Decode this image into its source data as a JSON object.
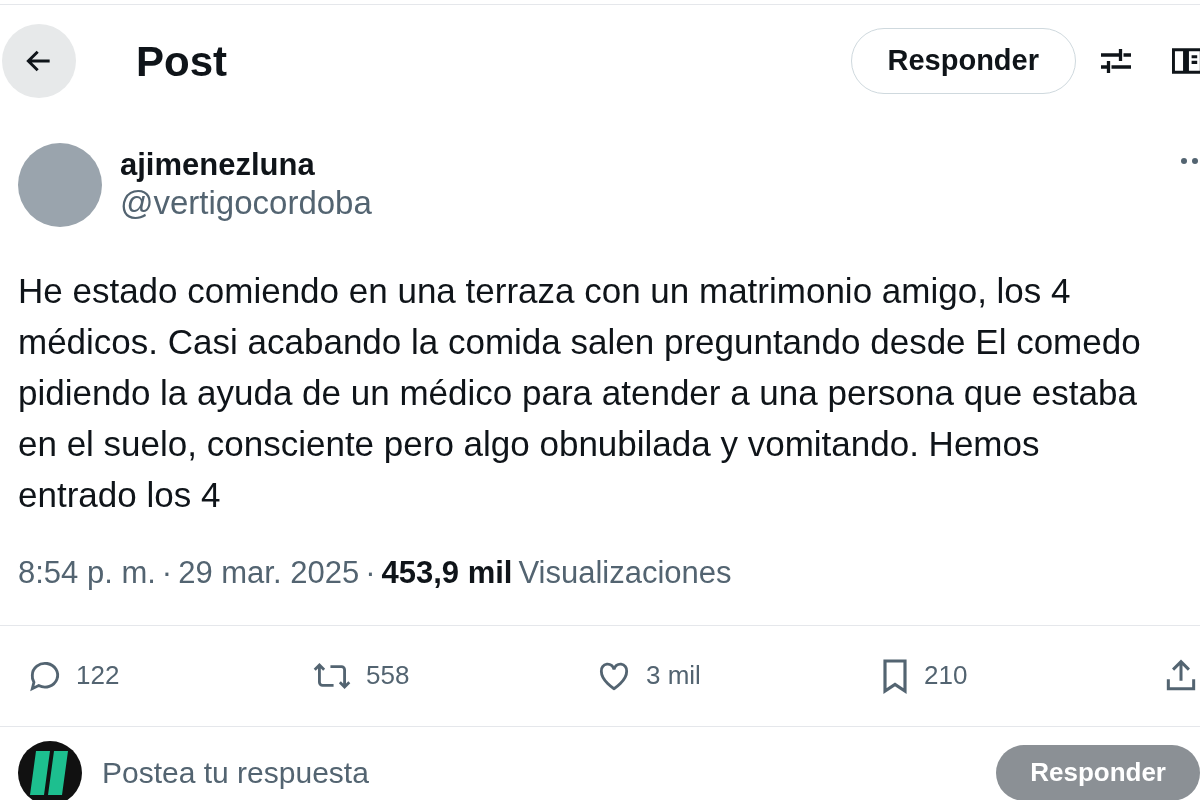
{
  "header": {
    "title": "Post",
    "reply_button": "Responder"
  },
  "author": {
    "name": "ajimenezluna",
    "handle": "@vertigocordoba"
  },
  "body_lines": [
    "He estado comiendo en una terraza con un matrimonio amigo, los 4",
    "médicos. Casi acabando la comida salen preguntando desde El comedo",
    "pidiendo la ayuda de un médico para atender a una persona que estaba",
    "en el suelo, consciente pero algo obnubilada y vomitando. Hemos",
    "entrado los 4"
  ],
  "meta": {
    "separator": "·",
    "time": "8:54 p. m.",
    "date": "29 mar. 2025",
    "views": "453,9 mil",
    "views_label": "Visualizaciones"
  },
  "actions": [
    {
      "kind": "reply",
      "count": "122"
    },
    {
      "kind": "repost",
      "count": "558"
    },
    {
      "kind": "like",
      "count": "3 mil"
    },
    {
      "kind": "bookmark",
      "count": "210"
    },
    {
      "kind": "share"
    }
  ],
  "composer": {
    "placeholder": "Postea tu respuesta",
    "button": "Responder"
  }
}
